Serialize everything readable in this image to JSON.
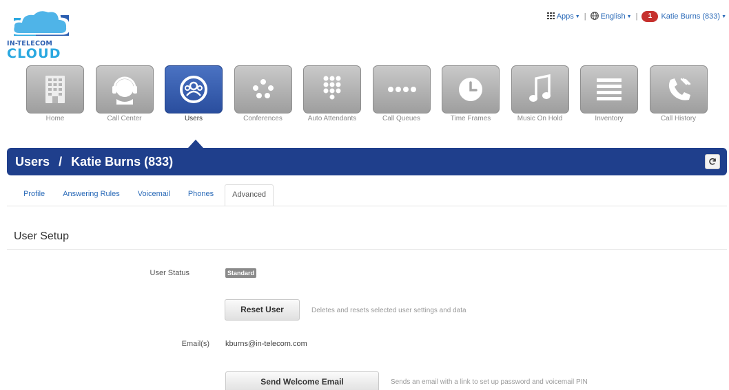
{
  "logo": {
    "line1": "IN-TELECOM",
    "line2": "CLOUD"
  },
  "topmenu": {
    "apps": "Apps",
    "language": "English",
    "notifications": "1",
    "user": "Katie Burns (833)"
  },
  "nav": [
    {
      "label": "Home",
      "icon": "building-icon"
    },
    {
      "label": "Call Center",
      "icon": "headset-icon"
    },
    {
      "label": "Users",
      "icon": "users-icon",
      "active": true
    },
    {
      "label": "Conferences",
      "icon": "conference-icon"
    },
    {
      "label": "Auto Attendants",
      "icon": "keypad-icon"
    },
    {
      "label": "Call Queues",
      "icon": "queue-icon"
    },
    {
      "label": "Time Frames",
      "icon": "clock-icon"
    },
    {
      "label": "Music On Hold",
      "icon": "music-icon"
    },
    {
      "label": "Inventory",
      "icon": "list-icon"
    },
    {
      "label": "Call History",
      "icon": "phone-history-icon"
    }
  ],
  "titlebar": {
    "section": "Users",
    "separator": "/",
    "subject": "Katie Burns (833)"
  },
  "tabs": [
    {
      "label": "Profile"
    },
    {
      "label": "Answering Rules"
    },
    {
      "label": "Voicemail"
    },
    {
      "label": "Phones"
    },
    {
      "label": "Advanced",
      "active": true
    }
  ],
  "setup": {
    "title": "User Setup",
    "status_label": "User Status",
    "status_value": "Standard",
    "reset_button": "Reset User",
    "reset_help": "Deletes and resets selected user settings and data",
    "email_label": "Email(s)",
    "email_value": "kburns@in-telecom.com",
    "welcome_button": "Send Welcome Email",
    "welcome_help": "Sends an email with a link to set up password and voicemail PIN"
  },
  "colors": {
    "primary": "#1f3f8c",
    "link": "#2a6ab8",
    "notification": "#c6302d",
    "tile": "#a8a8a8"
  }
}
